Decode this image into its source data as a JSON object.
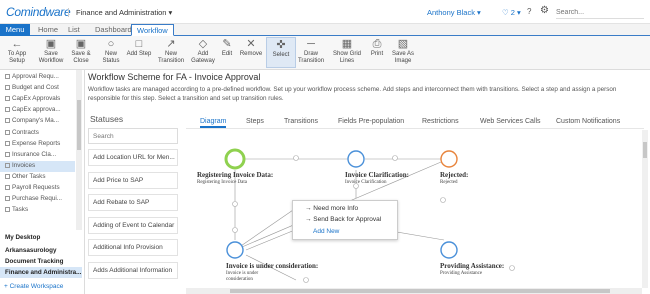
{
  "app": {
    "logo": "Comindware",
    "title": "Finance and Administration ▾"
  },
  "header": {
    "user": "Anthony Black ▾",
    "notifications": "♡ 2 ▾",
    "help": "?",
    "search_placeholder": "Search..."
  },
  "tabs": {
    "menu": "Menu",
    "home": "Home",
    "list": "List",
    "dashboard": "Dashboard",
    "workflow": "Workflow"
  },
  "ribbon": [
    {
      "label": "To App Setup",
      "icon": "←"
    },
    {
      "label": "Save Workflow",
      "icon": "▣"
    },
    {
      "label": "Save & Close",
      "icon": "▣"
    },
    {
      "label": "New Status",
      "icon": "○"
    },
    {
      "label": "Add Step",
      "icon": "□"
    },
    {
      "label": "New Transition",
      "icon": "↗"
    },
    {
      "label": "Add Gateway",
      "icon": "◇"
    },
    {
      "label": "Edit",
      "icon": "✎"
    },
    {
      "label": "Remove",
      "icon": "✕"
    },
    {
      "label": "Select",
      "icon": "✜"
    },
    {
      "label": "Draw Transition",
      "icon": "─"
    },
    {
      "label": "Show Grid Lines",
      "icon": "▦"
    },
    {
      "label": "Print",
      "icon": "⎙"
    },
    {
      "label": "Save As Image",
      "icon": "▧"
    }
  ],
  "sidebar": {
    "items": [
      "Approval Requ...",
      "Budget and Cost",
      "CapEx Approvals",
      "CapEx approva...",
      "Company's Ma...",
      "Contracts",
      "Expense Reports",
      "Insurance Cla...",
      "Invoices",
      "Other Tasks",
      "Payroll Requests",
      "Purchase Requi...",
      "Tasks"
    ],
    "workspaces": [
      "My Desktop",
      "Arkansasurology",
      "Document Tracking",
      "Finance and Administra..."
    ],
    "create_workspace": "+ Create Workspace"
  },
  "main": {
    "heading": "Workflow Scheme for FA - Invoice Approval",
    "description": "Workflow tasks are managed according to a pre-defined workflow. Set up your workflow process scheme. Add steps and interconnect them with transitions. Select a step and assign a person responsible for this step. Select a transition and set up transition rules."
  },
  "statuses": {
    "title": "Statuses",
    "search_placeholder": "Search",
    "items": [
      "Add Location URL for Men...",
      "Add Price to SAP",
      "Add Rebate to SAP",
      "Adding of Event to Calendar",
      "Additional Info Provision",
      "Adds Additional Information"
    ]
  },
  "diagram_tabs": [
    "Diagram",
    "Steps",
    "Transitions",
    "Fields Pre-population",
    "Restrictions",
    "Web Services Calls",
    "Custom Notifications"
  ],
  "nodes": [
    {
      "label": "Registering Invoice Data:",
      "sub": "Registering Invoice Data",
      "color": "#8fd14f"
    },
    {
      "label": "Invoice Clarification:",
      "sub": "Invoice Clarification",
      "color": "#4a90d9"
    },
    {
      "label": "Rejected:",
      "sub": "Rejected",
      "color": "#e8843c"
    },
    {
      "label": "Invoice is under consideration:",
      "sub": "Invoice is under",
      "sub2": "consideration",
      "color": "#4a90d9"
    },
    {
      "label": "Providing Assistance:",
      "sub": "Providing Assistance",
      "color": "#4a90d9"
    }
  ],
  "popup": {
    "items": [
      "→ Need more Info",
      "→ Send Back for Approval"
    ],
    "add_new": "Add New"
  },
  "colors": {
    "accent": "#1a73c9",
    "active_bg": "#d6e6f7"
  }
}
